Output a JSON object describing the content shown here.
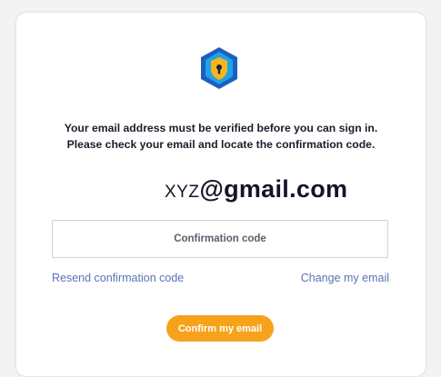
{
  "logo": {
    "icon": "shield-lock-icon",
    "colors": {
      "outer": "#1d5fbf",
      "inner": "#1fa1e6",
      "shield": "#f7b51c"
    }
  },
  "message": {
    "line1": "Your email address must be verified before you can sign in.",
    "line2": "Please check your email and locate the confirmation code."
  },
  "email": {
    "user": "XYZ",
    "domain": "@gmail.com"
  },
  "confirmation_input": {
    "placeholder": "Confirmation code",
    "value": ""
  },
  "links": {
    "resend": "Resend confirmation code",
    "change_email": "Change my email"
  },
  "confirm_button": {
    "label": "Confirm my email",
    "color": "#f7a21b"
  }
}
